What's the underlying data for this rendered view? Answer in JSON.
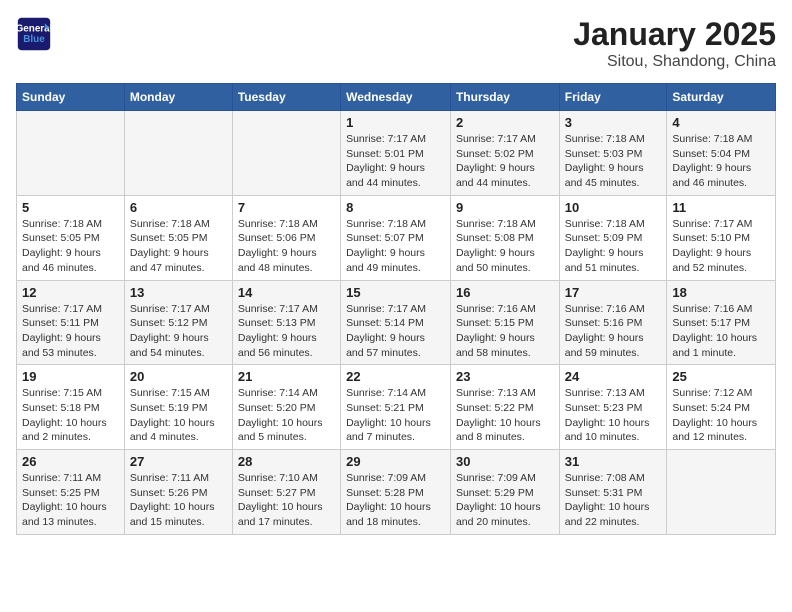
{
  "header": {
    "logo_line1": "General",
    "logo_line2": "Blue",
    "month": "January 2025",
    "location": "Sitou, Shandong, China"
  },
  "days_of_week": [
    "Sunday",
    "Monday",
    "Tuesday",
    "Wednesday",
    "Thursday",
    "Friday",
    "Saturday"
  ],
  "weeks": [
    [
      {
        "day": "",
        "detail": ""
      },
      {
        "day": "",
        "detail": ""
      },
      {
        "day": "",
        "detail": ""
      },
      {
        "day": "1",
        "detail": "Sunrise: 7:17 AM\nSunset: 5:01 PM\nDaylight: 9 hours\nand 44 minutes."
      },
      {
        "day": "2",
        "detail": "Sunrise: 7:17 AM\nSunset: 5:02 PM\nDaylight: 9 hours\nand 44 minutes."
      },
      {
        "day": "3",
        "detail": "Sunrise: 7:18 AM\nSunset: 5:03 PM\nDaylight: 9 hours\nand 45 minutes."
      },
      {
        "day": "4",
        "detail": "Sunrise: 7:18 AM\nSunset: 5:04 PM\nDaylight: 9 hours\nand 46 minutes."
      }
    ],
    [
      {
        "day": "5",
        "detail": "Sunrise: 7:18 AM\nSunset: 5:05 PM\nDaylight: 9 hours\nand 46 minutes."
      },
      {
        "day": "6",
        "detail": "Sunrise: 7:18 AM\nSunset: 5:05 PM\nDaylight: 9 hours\nand 47 minutes."
      },
      {
        "day": "7",
        "detail": "Sunrise: 7:18 AM\nSunset: 5:06 PM\nDaylight: 9 hours\nand 48 minutes."
      },
      {
        "day": "8",
        "detail": "Sunrise: 7:18 AM\nSunset: 5:07 PM\nDaylight: 9 hours\nand 49 minutes."
      },
      {
        "day": "9",
        "detail": "Sunrise: 7:18 AM\nSunset: 5:08 PM\nDaylight: 9 hours\nand 50 minutes."
      },
      {
        "day": "10",
        "detail": "Sunrise: 7:18 AM\nSunset: 5:09 PM\nDaylight: 9 hours\nand 51 minutes."
      },
      {
        "day": "11",
        "detail": "Sunrise: 7:17 AM\nSunset: 5:10 PM\nDaylight: 9 hours\nand 52 minutes."
      }
    ],
    [
      {
        "day": "12",
        "detail": "Sunrise: 7:17 AM\nSunset: 5:11 PM\nDaylight: 9 hours\nand 53 minutes."
      },
      {
        "day": "13",
        "detail": "Sunrise: 7:17 AM\nSunset: 5:12 PM\nDaylight: 9 hours\nand 54 minutes."
      },
      {
        "day": "14",
        "detail": "Sunrise: 7:17 AM\nSunset: 5:13 PM\nDaylight: 9 hours\nand 56 minutes."
      },
      {
        "day": "15",
        "detail": "Sunrise: 7:17 AM\nSunset: 5:14 PM\nDaylight: 9 hours\nand 57 minutes."
      },
      {
        "day": "16",
        "detail": "Sunrise: 7:16 AM\nSunset: 5:15 PM\nDaylight: 9 hours\nand 58 minutes."
      },
      {
        "day": "17",
        "detail": "Sunrise: 7:16 AM\nSunset: 5:16 PM\nDaylight: 9 hours\nand 59 minutes."
      },
      {
        "day": "18",
        "detail": "Sunrise: 7:16 AM\nSunset: 5:17 PM\nDaylight: 10 hours\nand 1 minute."
      }
    ],
    [
      {
        "day": "19",
        "detail": "Sunrise: 7:15 AM\nSunset: 5:18 PM\nDaylight: 10 hours\nand 2 minutes."
      },
      {
        "day": "20",
        "detail": "Sunrise: 7:15 AM\nSunset: 5:19 PM\nDaylight: 10 hours\nand 4 minutes."
      },
      {
        "day": "21",
        "detail": "Sunrise: 7:14 AM\nSunset: 5:20 PM\nDaylight: 10 hours\nand 5 minutes."
      },
      {
        "day": "22",
        "detail": "Sunrise: 7:14 AM\nSunset: 5:21 PM\nDaylight: 10 hours\nand 7 minutes."
      },
      {
        "day": "23",
        "detail": "Sunrise: 7:13 AM\nSunset: 5:22 PM\nDaylight: 10 hours\nand 8 minutes."
      },
      {
        "day": "24",
        "detail": "Sunrise: 7:13 AM\nSunset: 5:23 PM\nDaylight: 10 hours\nand 10 minutes."
      },
      {
        "day": "25",
        "detail": "Sunrise: 7:12 AM\nSunset: 5:24 PM\nDaylight: 10 hours\nand 12 minutes."
      }
    ],
    [
      {
        "day": "26",
        "detail": "Sunrise: 7:11 AM\nSunset: 5:25 PM\nDaylight: 10 hours\nand 13 minutes."
      },
      {
        "day": "27",
        "detail": "Sunrise: 7:11 AM\nSunset: 5:26 PM\nDaylight: 10 hours\nand 15 minutes."
      },
      {
        "day": "28",
        "detail": "Sunrise: 7:10 AM\nSunset: 5:27 PM\nDaylight: 10 hours\nand 17 minutes."
      },
      {
        "day": "29",
        "detail": "Sunrise: 7:09 AM\nSunset: 5:28 PM\nDaylight: 10 hours\nand 18 minutes."
      },
      {
        "day": "30",
        "detail": "Sunrise: 7:09 AM\nSunset: 5:29 PM\nDaylight: 10 hours\nand 20 minutes."
      },
      {
        "day": "31",
        "detail": "Sunrise: 7:08 AM\nSunset: 5:31 PM\nDaylight: 10 hours\nand 22 minutes."
      },
      {
        "day": "",
        "detail": ""
      }
    ]
  ]
}
